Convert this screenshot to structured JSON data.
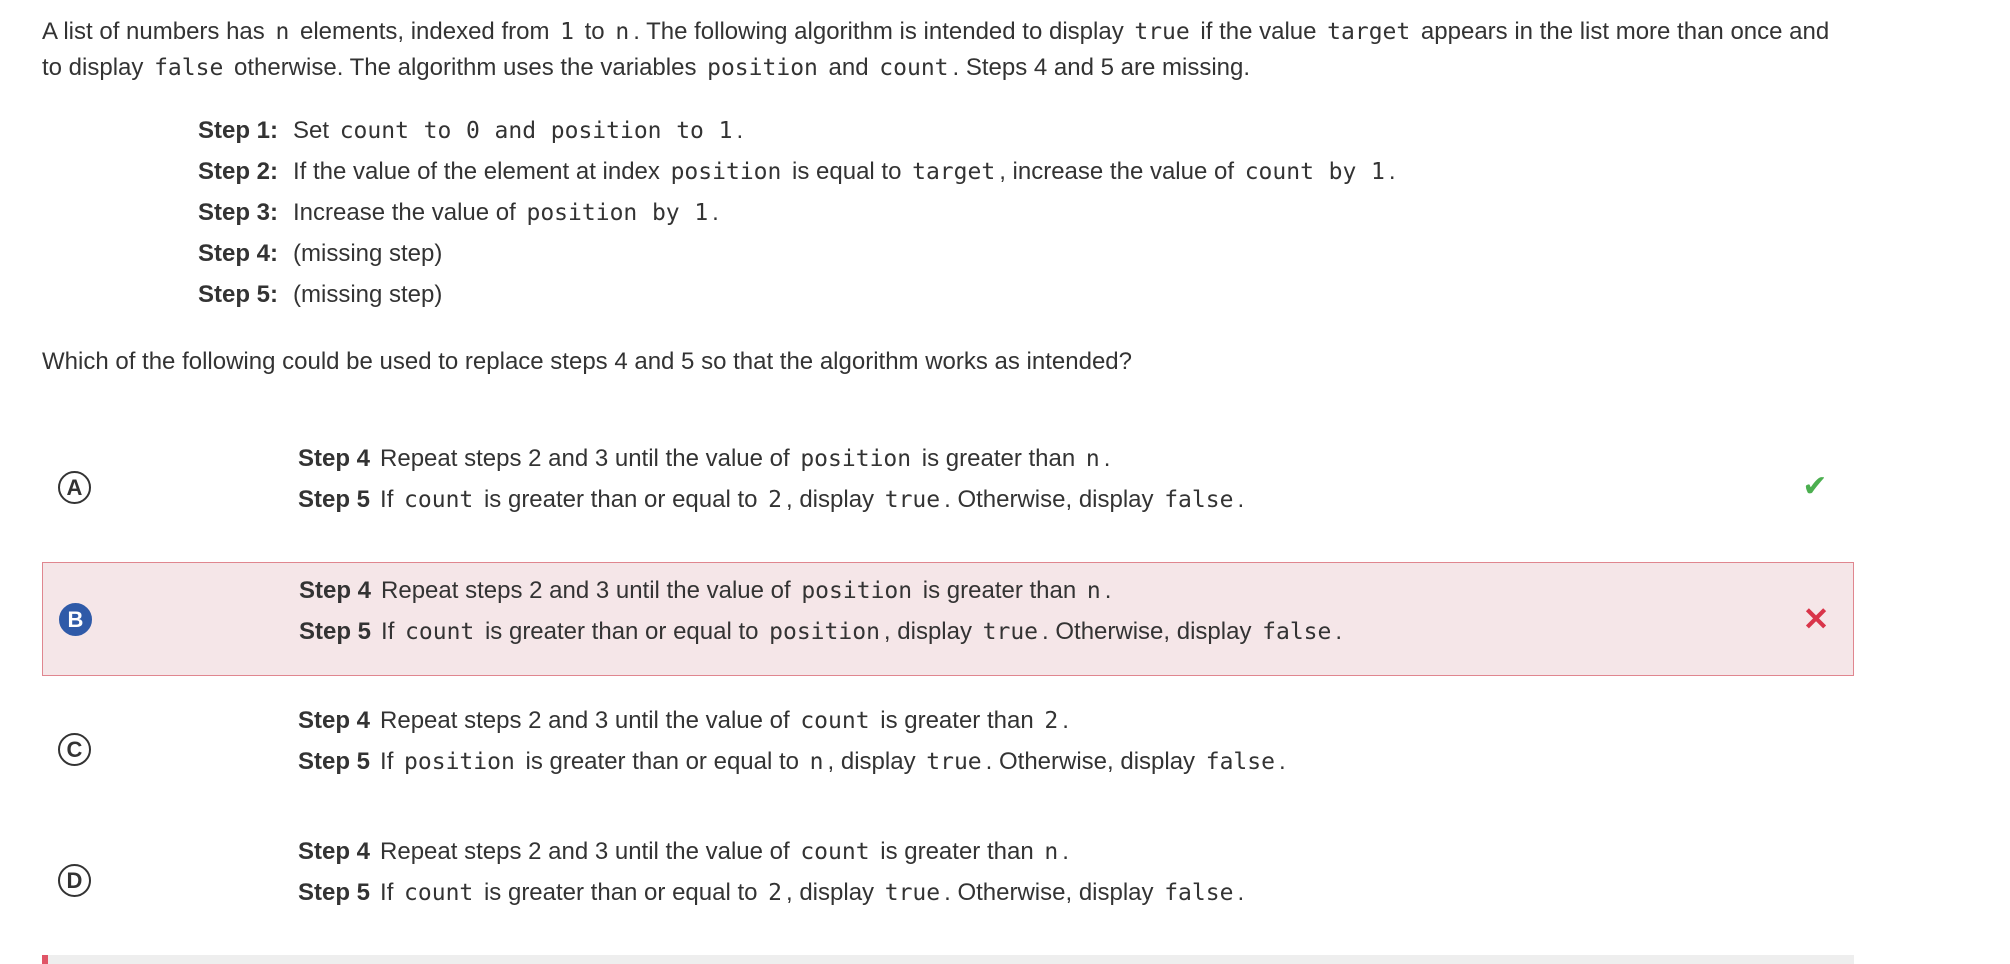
{
  "prompt": {
    "t1": "A list of numbers has ",
    "c1": "n",
    "t2": " elements, indexed from ",
    "c2": "1",
    "t3": " to ",
    "c3": "n",
    "t4": ".  The following algorithm is intended to display ",
    "c4": "true",
    "t5": " if the value ",
    "c5": "target",
    "t6": " appears in the list more than once and to display ",
    "c6": "false",
    "t7": " otherwise. The algorithm uses the variables ",
    "c7": "position",
    "t8": " and ",
    "c8": "count",
    "t9": ".  Steps 4 and 5 are missing."
  },
  "steps": [
    {
      "label": "Step 1:",
      "parts": [
        [
          "t",
          "Set "
        ],
        [
          "c",
          "count"
        ],
        [
          "t",
          " "
        ],
        [
          "c",
          "to"
        ],
        [
          "t",
          " "
        ],
        [
          "c",
          "0"
        ],
        [
          "t",
          " "
        ],
        [
          "c",
          "and"
        ],
        [
          "t",
          " "
        ],
        [
          "c",
          "position"
        ],
        [
          "t",
          " "
        ],
        [
          "c",
          "to"
        ],
        [
          "t",
          " "
        ],
        [
          "c",
          "1"
        ],
        [
          "t",
          "."
        ]
      ]
    },
    {
      "label": "Step 2:",
      "parts": [
        [
          "t",
          "If the value of the element at index "
        ],
        [
          "c",
          "position"
        ],
        [
          "t",
          " is equal to "
        ],
        [
          "c",
          "target"
        ],
        [
          "t",
          ",  increase the value of "
        ],
        [
          "c",
          "count"
        ],
        [
          "t",
          " "
        ],
        [
          "c",
          "by"
        ],
        [
          "t",
          " "
        ],
        [
          "c",
          "1"
        ],
        [
          "t",
          "."
        ]
      ]
    },
    {
      "label": "Step 3:",
      "parts": [
        [
          "t",
          "Increase the value of "
        ],
        [
          "c",
          "position"
        ],
        [
          "t",
          " "
        ],
        [
          "c",
          "by"
        ],
        [
          "t",
          " "
        ],
        [
          "c",
          "1"
        ],
        [
          "t",
          "."
        ]
      ]
    },
    {
      "label": "Step 4:",
      "parts": [
        [
          "t",
          "(missing step)"
        ]
      ]
    },
    {
      "label": "Step 5:",
      "parts": [
        [
          "t",
          "(missing step)"
        ]
      ]
    }
  ],
  "question": "Which of the following could be used to replace steps 4 and 5 so that the algorithm works as intended?",
  "choices": [
    {
      "letter": "A",
      "selected": false,
      "mark": "✔",
      "line1": {
        "label": "Step 4",
        "parts": [
          [
            "t",
            "Repeat steps 2 and 3 until the value of "
          ],
          [
            "c",
            "position"
          ],
          [
            "t",
            " is greater than "
          ],
          [
            "c",
            "n"
          ],
          [
            "t",
            "."
          ]
        ]
      },
      "line2": {
        "label": "Step 5",
        "parts": [
          [
            "t",
            "If "
          ],
          [
            "c",
            "count"
          ],
          [
            "t",
            " is greater than or equal to "
          ],
          [
            "c",
            "2"
          ],
          [
            "t",
            ",  display "
          ],
          [
            "c",
            "true"
          ],
          [
            "t",
            ".  Otherwise, display "
          ],
          [
            "c",
            "false"
          ],
          [
            "t",
            "."
          ]
        ]
      }
    },
    {
      "letter": "B",
      "selected": true,
      "mark": "✕",
      "line1": {
        "label": "Step 4",
        "parts": [
          [
            "t",
            "Repeat steps 2 and 3 until the value of "
          ],
          [
            "c",
            "position"
          ],
          [
            "t",
            " is greater than "
          ],
          [
            "c",
            "n"
          ],
          [
            "t",
            "."
          ]
        ]
      },
      "line2": {
        "label": "Step 5",
        "parts": [
          [
            "t",
            "If "
          ],
          [
            "c",
            "count"
          ],
          [
            "t",
            " is greater than or equal to "
          ],
          [
            "c",
            "position"
          ],
          [
            "t",
            ",  display "
          ],
          [
            "c",
            "true"
          ],
          [
            "t",
            ". Otherwise, display "
          ],
          [
            "c",
            "false"
          ],
          [
            "t",
            "."
          ]
        ]
      }
    },
    {
      "letter": "C",
      "selected": false,
      "mark": "",
      "line1": {
        "label": "Step 4",
        "parts": [
          [
            "t",
            "Repeat steps 2 and 3 until the value of "
          ],
          [
            "c",
            "count"
          ],
          [
            "t",
            " is greater than "
          ],
          [
            "c",
            "2"
          ],
          [
            "t",
            "."
          ]
        ]
      },
      "line2": {
        "label": "Step 5",
        "parts": [
          [
            "t",
            "If "
          ],
          [
            "c",
            "position"
          ],
          [
            "t",
            " is greater than or equal to "
          ],
          [
            "c",
            "n"
          ],
          [
            "t",
            ",  display "
          ],
          [
            "c",
            "true"
          ],
          [
            "t",
            ".  Otherwise, display "
          ],
          [
            "c",
            "false"
          ],
          [
            "t",
            "."
          ]
        ]
      }
    },
    {
      "letter": "D",
      "selected": false,
      "mark": "",
      "line1": {
        "label": "Step 4",
        "parts": [
          [
            "t",
            "Repeat steps 2 and 3 until the value of "
          ],
          [
            "c",
            "count"
          ],
          [
            "t",
            " is greater than "
          ],
          [
            "c",
            "n"
          ],
          [
            "t",
            "."
          ]
        ]
      },
      "line2": {
        "label": "Step 5",
        "parts": [
          [
            "t",
            "If "
          ],
          [
            "c",
            "count"
          ],
          [
            "t",
            " is greater than or equal to "
          ],
          [
            "c",
            "2"
          ],
          [
            "t",
            ",  display "
          ],
          [
            "c",
            "true"
          ],
          [
            "t",
            ".  Otherwise, display "
          ],
          [
            "c",
            "false"
          ],
          [
            "t",
            "."
          ]
        ]
      }
    }
  ],
  "colors": {
    "correct": "#4caf50",
    "incorrect": "#d9354a",
    "selected_bg": "#f5e6e8",
    "selected_border": "#e0868f",
    "selected_letter": "#2f5aa8"
  }
}
